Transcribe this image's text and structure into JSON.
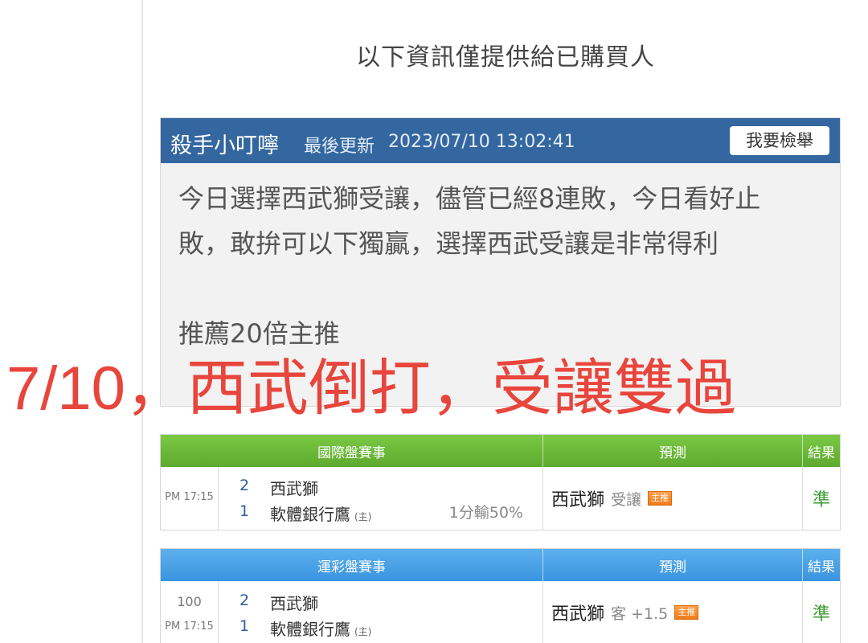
{
  "notice": "以下資訊僅提供給已購買人",
  "post": {
    "author": "殺手小叮嚀",
    "update_label": "最後更新",
    "update_time": "2023/07/10 13:02:41",
    "report_button": "我要檢舉",
    "line1": "今日選擇西武獅受讓，儘管已經8連敗，今日看好止",
    "line2": "敗，敢拚可以下獨贏，選擇西武受讓是非常得利",
    "line3": "推薦20倍主推"
  },
  "overlay_text": "7/10，西武倒打，受讓雙過",
  "international": {
    "header_match": "國際盤賽事",
    "header_prediction": "預測",
    "header_result": "結果",
    "time": "PM 17:15",
    "away_score": "2",
    "away_team": "西武獅",
    "home_score": "1",
    "home_team": "軟體銀行鷹",
    "home_tag": "(主)",
    "result_detail": "1分輸50%",
    "pred_team": "西武獅",
    "pred_pick": "受讓",
    "badge": "主推",
    "result": "準"
  },
  "sports_lottery": {
    "header_match": "運彩盤賽事",
    "header_prediction": "預測",
    "header_result": "結果",
    "code": "100",
    "time": "PM 17:15",
    "away_score": "2",
    "away_team": "西武獅",
    "home_score": "1",
    "home_team": "軟體銀行鷹",
    "home_tag": "(主)",
    "pred_team": "西武獅",
    "pred_pick": "客 +1.5",
    "badge": "主推",
    "result": "準"
  },
  "colors": {
    "header_blue": "#34679f",
    "green_header": "#6cb93a",
    "blue_header": "#4aa2e6",
    "overlay_red": "#e8453c",
    "result_green": "#3a9a2f",
    "badge_orange": "#f08a25"
  }
}
